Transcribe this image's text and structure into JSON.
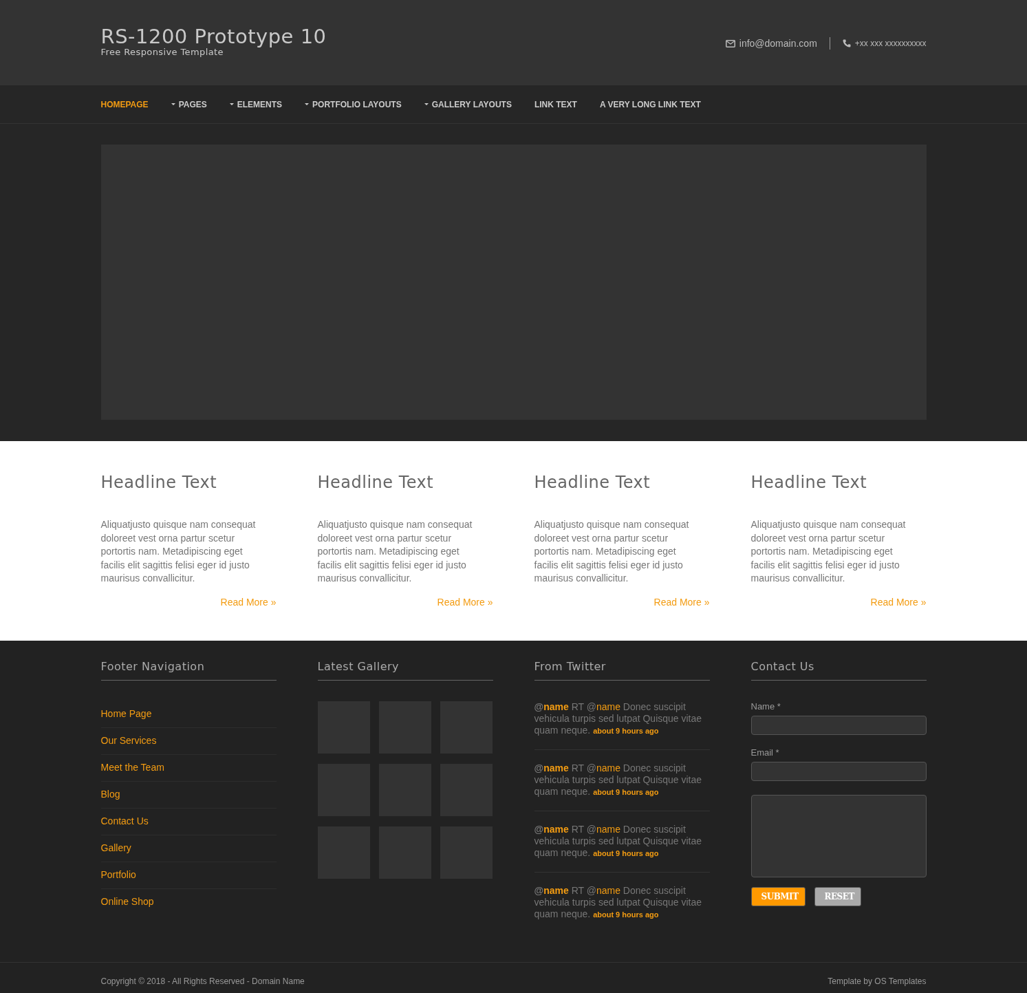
{
  "header": {
    "title": "RS-1200 Prototype 10",
    "tagline": "Free Responsive Template",
    "email": "info@domain.com",
    "phone": "+xx xxx xxxxxxxxxx"
  },
  "nav": [
    {
      "label": "HOMEPAGE",
      "selected": true,
      "dropdown": false
    },
    {
      "label": "PAGES",
      "selected": false,
      "dropdown": true
    },
    {
      "label": "ELEMENTS",
      "selected": false,
      "dropdown": true
    },
    {
      "label": "PORTFOLIO LAYOUTS",
      "selected": false,
      "dropdown": true
    },
    {
      "label": "GALLERY LAYOUTS",
      "selected": false,
      "dropdown": true
    },
    {
      "label": "LINK TEXT",
      "selected": false,
      "dropdown": false
    },
    {
      "label": "A VERY LONG LINK TEXT",
      "selected": false,
      "dropdown": false
    }
  ],
  "features": [
    {
      "title": "Headline Text",
      "text": "Aliquatjusto quisque nam consequat doloreet vest orna partur scetur portortis nam. Metadipiscing eget facilis elit sagittis felisi eger id justo maurisus convallicitur.",
      "link": "Read More »"
    },
    {
      "title": "Headline Text",
      "text": "Aliquatjusto quisque nam consequat doloreet vest orna partur scetur portortis nam. Metadipiscing eget facilis elit sagittis felisi eger id justo maurisus convallicitur.",
      "link": "Read More »"
    },
    {
      "title": "Headline Text",
      "text": "Aliquatjusto quisque nam consequat doloreet vest orna partur scetur portortis nam. Metadipiscing eget facilis elit sagittis felisi eger id justo maurisus convallicitur.",
      "link": "Read More »"
    },
    {
      "title": "Headline Text",
      "text": "Aliquatjusto quisque nam consequat doloreet vest orna partur scetur portortis nam. Metadipiscing eget facilis elit sagittis felisi eger id justo maurisus convallicitur.",
      "link": "Read More »"
    }
  ],
  "footer_nav": {
    "title": "Footer Navigation",
    "items": [
      "Home Page",
      "Our Services",
      "Meet the Team",
      "Blog",
      "Contact Us",
      "Gallery",
      "Portfolio",
      "Online Shop"
    ]
  },
  "gallery": {
    "title": "Latest Gallery",
    "items": [
      {
        "kind": "placeholder"
      },
      {
        "kind": "placeholder"
      },
      {
        "kind": "placeholder"
      },
      {
        "kind": "placeholder"
      },
      {
        "kind": "placeholder"
      },
      {
        "kind": "placeholder"
      },
      {
        "kind": "placeholder"
      },
      {
        "kind": "placeholder"
      },
      {
        "kind": "placeholder"
      }
    ]
  },
  "twitter": {
    "title": "From Twitter",
    "tweets": [
      {
        "at": "@",
        "user": "name",
        "rt": "RT",
        "mention_at": "@",
        "mention": "name",
        "body": "Donec suscipit vehicula turpis sed lutpat Quisque vitae quam neque.",
        "time": "about 9 hours ago"
      },
      {
        "at": "@",
        "user": "name",
        "rt": "RT",
        "mention_at": "@",
        "mention": "name",
        "body": "Donec suscipit vehicula turpis sed lutpat Quisque vitae quam neque.",
        "time": "about 9 hours ago"
      },
      {
        "at": "@",
        "user": "name",
        "rt": "RT",
        "mention_at": "@",
        "mention": "name",
        "body": "Donec suscipit vehicula turpis sed lutpat Quisque vitae quam neque.",
        "time": "about 9 hours ago"
      },
      {
        "at": "@",
        "user": "name",
        "rt": "RT",
        "mention_at": "@",
        "mention": "name",
        "body": "Donec suscipit vehicula turpis sed lutpat Quisque vitae quam neque.",
        "time": "about 9 hours ago"
      }
    ]
  },
  "contact": {
    "title": "Contact Us",
    "fields": [
      {
        "kind": "input",
        "label": "Name *"
      },
      {
        "kind": "input",
        "label": "Email *"
      },
      {
        "kind": "textarea"
      }
    ],
    "buttons": [
      {
        "kind": "primary",
        "label": "SUBMIT"
      },
      {
        "kind": "secondary",
        "label": "RESET"
      }
    ]
  },
  "copyright": {
    "left": "Copyright © 2018 - All Rights Reserved - Domain Name",
    "right": "Template by OS Templates"
  }
}
